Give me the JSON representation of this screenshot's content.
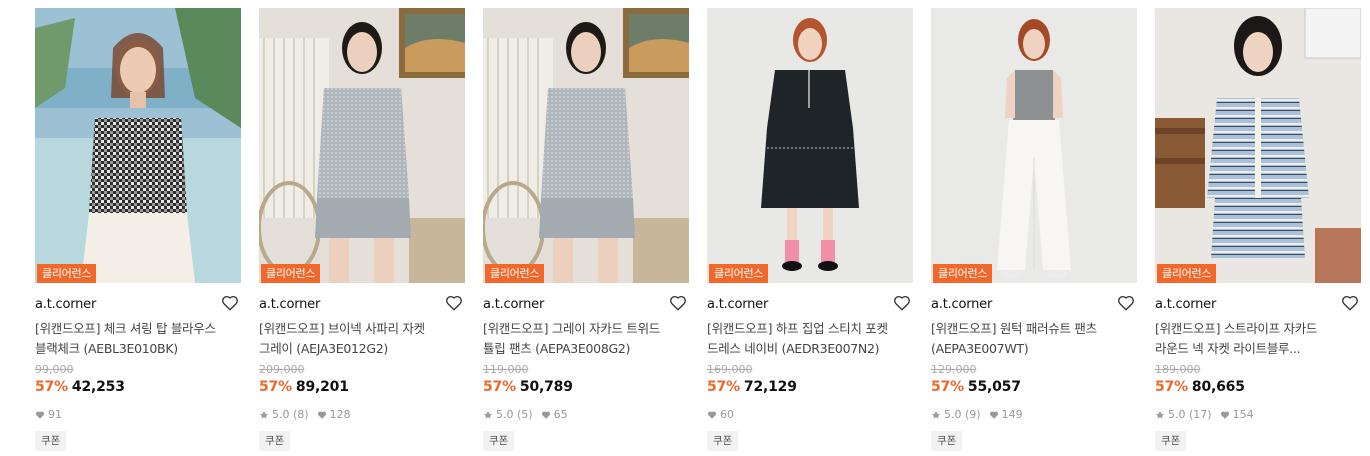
{
  "products": [
    {
      "badge": "클리어런스",
      "brand": "a.t.corner",
      "name_line1": "[위캔드오프] 체크 셔링 탑 블라우스",
      "name_line2": "블랙체크 (AEBL3E010BK)",
      "original_price": "99,000",
      "discount": "57%",
      "price": "42,253",
      "rating": "",
      "reviews": "",
      "likes": "91",
      "coupon": "쿠폰"
    },
    {
      "badge": "클리어런스",
      "brand": "a.t.corner",
      "name_line1": "[위캔드오프] 브이넥 사파리 자켓",
      "name_line2": "그레이 (AEJA3E012G2)",
      "original_price": "209,000",
      "discount": "57%",
      "price": "89,201",
      "rating": "5.0",
      "reviews": "(8)",
      "likes": "128",
      "coupon": "쿠폰"
    },
    {
      "badge": "클리어런스",
      "brand": "a.t.corner",
      "name_line1": "[위캔드오프] 그레이 자카드 트위드",
      "name_line2": "튤립 팬츠 (AEPA3E008G2)",
      "original_price": "119,000",
      "discount": "57%",
      "price": "50,789",
      "rating": "5.0",
      "reviews": "(5)",
      "likes": "65",
      "coupon": "쿠폰"
    },
    {
      "badge": "클리어런스",
      "brand": "a.t.corner",
      "name_line1": "[위캔드오프] 하프 집업 스티치 포켓",
      "name_line2": "드레스 네이비 (AEDR3E007N2)",
      "original_price": "169,000",
      "discount": "57%",
      "price": "72,129",
      "rating": "",
      "reviews": "",
      "likes": "60",
      "coupon": "쿠폰"
    },
    {
      "badge": "클리어런스",
      "brand": "a.t.corner",
      "name_line1": "[위캔드오프] 원턱 패러슈트 팬츠",
      "name_line2": "(AEPA3E007WT)",
      "original_price": "129,000",
      "discount": "57%",
      "price": "55,057",
      "rating": "5.0",
      "reviews": "(9)",
      "likes": "149",
      "coupon": "쿠폰"
    },
    {
      "badge": "클리어런스",
      "brand": "a.t.corner",
      "name_line1": "[위캔드오프] 스트라이프 자카드",
      "name_line2": "라운드 넥 자켓 라이트블루...",
      "original_price": "189,000",
      "discount": "57%",
      "price": "80,665",
      "rating": "5.0",
      "reviews": "(17)",
      "likes": "154",
      "coupon": "쿠폰"
    }
  ],
  "colors": {
    "accent": "#f2682a",
    "price_text": "#111111",
    "muted": "#999999"
  }
}
